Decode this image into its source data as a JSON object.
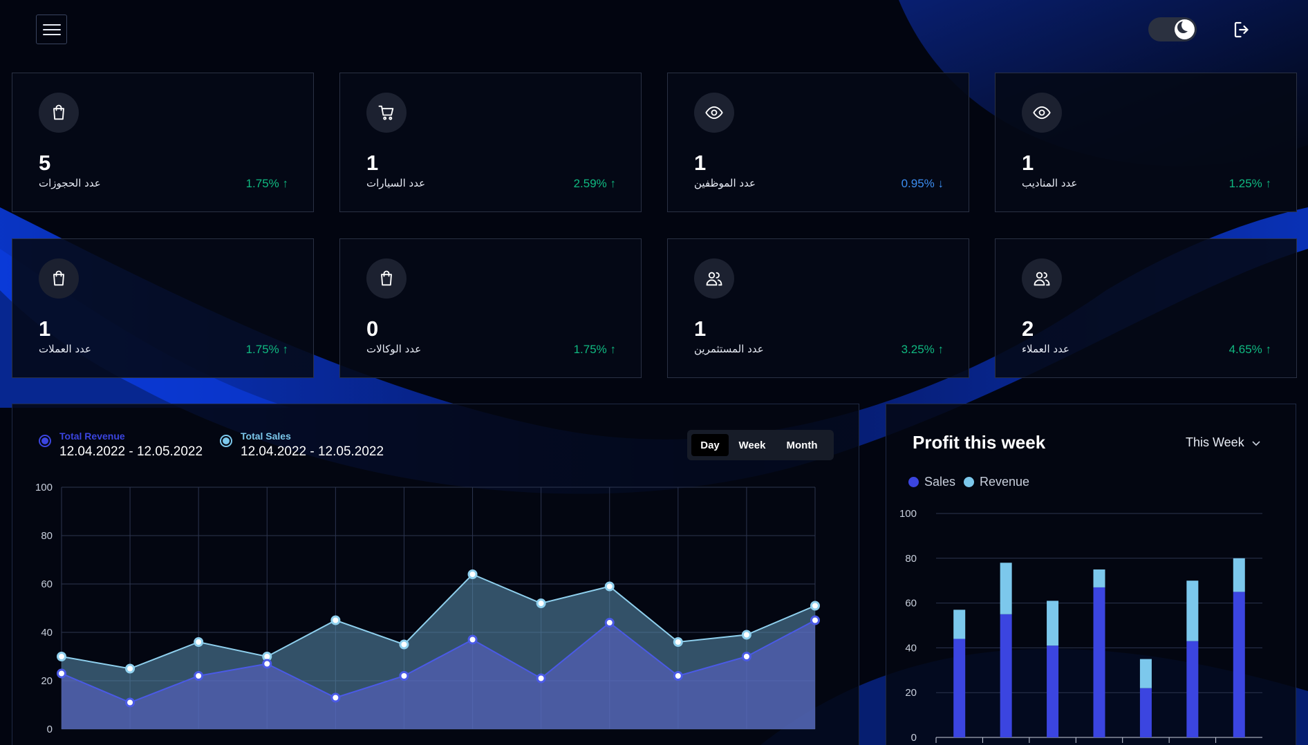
{
  "header": {
    "menu_icon": "hamburger-icon",
    "theme_icon": "moon-icon",
    "logout_icon": "logout-icon"
  },
  "colors": {
    "background": "#020510",
    "accent_blue": "#0a3ad8",
    "card_bg": "#050916",
    "up_green": "#10b981",
    "down_blue": "#3c8df0",
    "sales_blue": "#3b45e0",
    "revenue_light": "#7cc8ec"
  },
  "stats": [
    {
      "value": "5",
      "label": "عدد الحجوزات",
      "change": "1.75%",
      "trend": "up",
      "icon": "shopping-bag-icon"
    },
    {
      "value": "1",
      "label": "عدد السيارات",
      "change": "2.59%",
      "trend": "up",
      "icon": "shopping-cart-icon"
    },
    {
      "value": "1",
      "label": "عدد الموظفين",
      "change": "0.95%",
      "trend": "down",
      "icon": "eye-icon"
    },
    {
      "value": "1",
      "label": "عدد المناديب",
      "change": "1.25%",
      "trend": "up",
      "icon": "eye-icon"
    },
    {
      "value": "1",
      "label": "عدد العملات",
      "change": "1.75%",
      "trend": "up",
      "icon": "shopping-bag-icon"
    },
    {
      "value": "0",
      "label": "عدد الوكالات",
      "change": "1.75%",
      "trend": "up",
      "icon": "shopping-bag-icon"
    },
    {
      "value": "1",
      "label": "عدد المستثمرين",
      "change": "3.25%",
      "trend": "up",
      "icon": "users-icon"
    },
    {
      "value": "2",
      "label": "عدد العملاء",
      "change": "4.65%",
      "trend": "up",
      "icon": "users-icon"
    }
  ],
  "revenue_panel": {
    "legend": [
      {
        "title": "Total Revenue",
        "range": "12.04.2022 - 12.05.2022",
        "color": "#3b45e0"
      },
      {
        "title": "Total Sales",
        "range": "12.04.2022 - 12.05.2022",
        "color": "#7cc8ec"
      }
    ],
    "tabs": [
      "Day",
      "Week",
      "Month"
    ],
    "active_tab": "Day"
  },
  "profit_panel": {
    "title": "Profit this week",
    "period_select": "This Week",
    "legend": [
      "Sales",
      "Revenue"
    ]
  },
  "chart_data": [
    {
      "type": "area",
      "ylim": [
        0,
        100
      ],
      "y_ticks": [
        0,
        20,
        40,
        60,
        80,
        100
      ],
      "grid": true,
      "series": [
        {
          "name": "Total Sales",
          "values": [
            30,
            25,
            36,
            30,
            45,
            35,
            64,
            52,
            59,
            36,
            39,
            51
          ]
        },
        {
          "name": "Total Revenue",
          "values": [
            23,
            11,
            22,
            27,
            13,
            22,
            37,
            21,
            44,
            22,
            30,
            45
          ]
        }
      ]
    },
    {
      "type": "bar",
      "stacked": true,
      "ylim": [
        0,
        100
      ],
      "y_ticks": [
        0,
        20,
        40,
        60,
        80,
        100
      ],
      "grid": true,
      "series": [
        {
          "name": "Sales",
          "values": [
            44,
            55,
            41,
            67,
            22,
            43,
            65
          ]
        },
        {
          "name": "Revenue",
          "values": [
            13,
            23,
            20,
            8,
            13,
            27,
            15
          ]
        }
      ]
    }
  ]
}
